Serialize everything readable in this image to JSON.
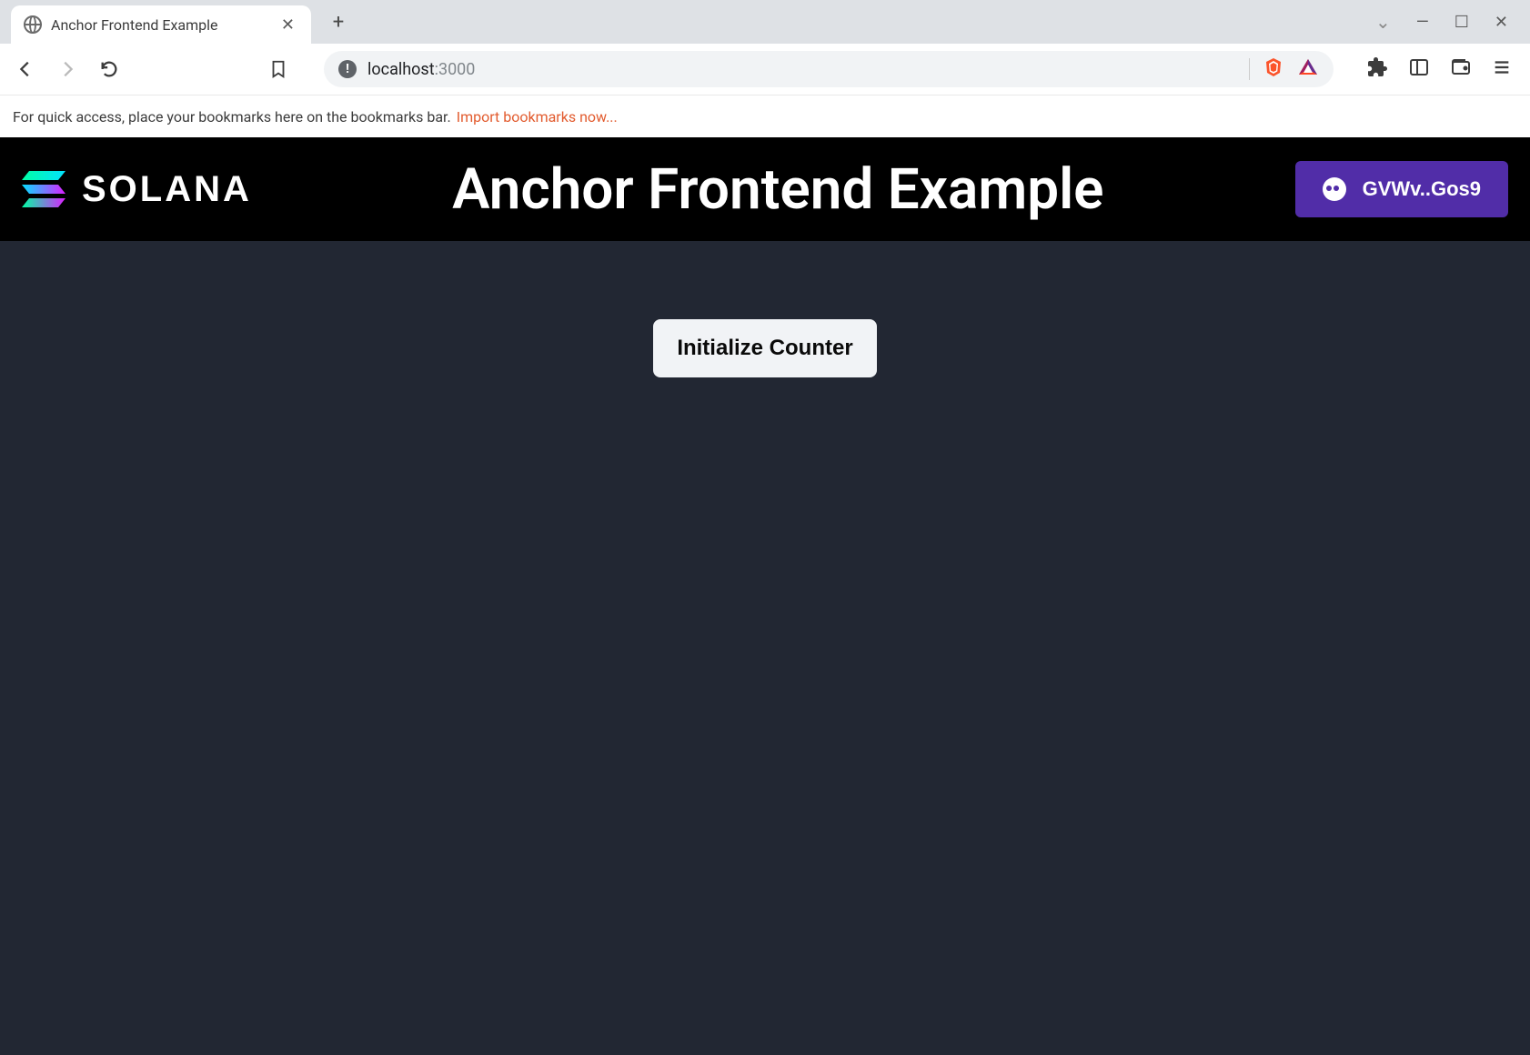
{
  "browser": {
    "tab_title": "Anchor Frontend Example",
    "url_host": "localhost",
    "url_port": ":3000",
    "bookmarks_hint": "For quick access, place your bookmarks here on the bookmarks bar.",
    "import_link": "Import bookmarks now..."
  },
  "app": {
    "logo_text": "SOLANA",
    "title": "Anchor Frontend Example",
    "wallet_label": "GVWv..Gos9",
    "init_button_label": "Initialize Counter"
  },
  "colors": {
    "page_bg": "#222733",
    "header_bg": "#000000",
    "wallet_btn": "#512da8",
    "link": "#e25b2e"
  }
}
